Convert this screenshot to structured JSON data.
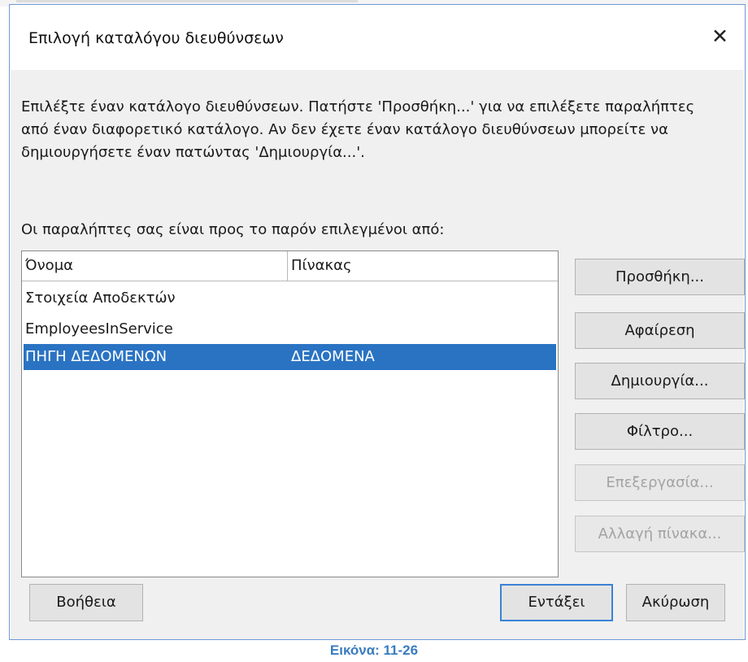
{
  "dialog": {
    "title": "Επιλογή καταλόγου διευθύνσεων",
    "close_icon": "close-icon",
    "description": "Επιλέξτε έναν κατάλογο διευθύνσεων. Πατήστε 'Προσθήκη...' για να επιλέξετε παραλήπτες από έναν διαφορετικό κατάλογο. Αν δεν έχετε έναν κατάλογο διευθύνσεων μπορείτε να δημιουργήσετε έναν πατώντας 'Δημιουργία...'.",
    "list_label": "Οι παραλήπτες σας είναι προς το παρόν επιλεγμένοι από:"
  },
  "list": {
    "headers": {
      "name": "Όνομα",
      "table": "Πίνακας"
    },
    "rows": [
      {
        "name": "Στοιχεία Αποδεκτών",
        "table": "",
        "selected": false
      },
      {
        "name": "EmployeesInService",
        "table": "",
        "selected": false
      },
      {
        "name": "ΠΗΓΗ ΔΕΔΟΜΕΝΩΝ",
        "table": "ΔΕΔΟΜΕΝΑ",
        "selected": true
      }
    ]
  },
  "side_buttons": {
    "add": "Προσθήκη...",
    "remove": "Αφαίρεση",
    "create": "Δημιουργία...",
    "filter": "Φίλτρο...",
    "edit": "Επεξεργασία...",
    "change_table": "Αλλαγή πίνακα..."
  },
  "footer": {
    "help": "Βοήθεια",
    "ok": "Εντάξει",
    "cancel": "Ακύρωση"
  },
  "caption": "Εικόνα: 11-26",
  "colors": {
    "selection": "#2a73c3",
    "caption": "#3a7cc0",
    "default_border": "#3a82d6"
  }
}
